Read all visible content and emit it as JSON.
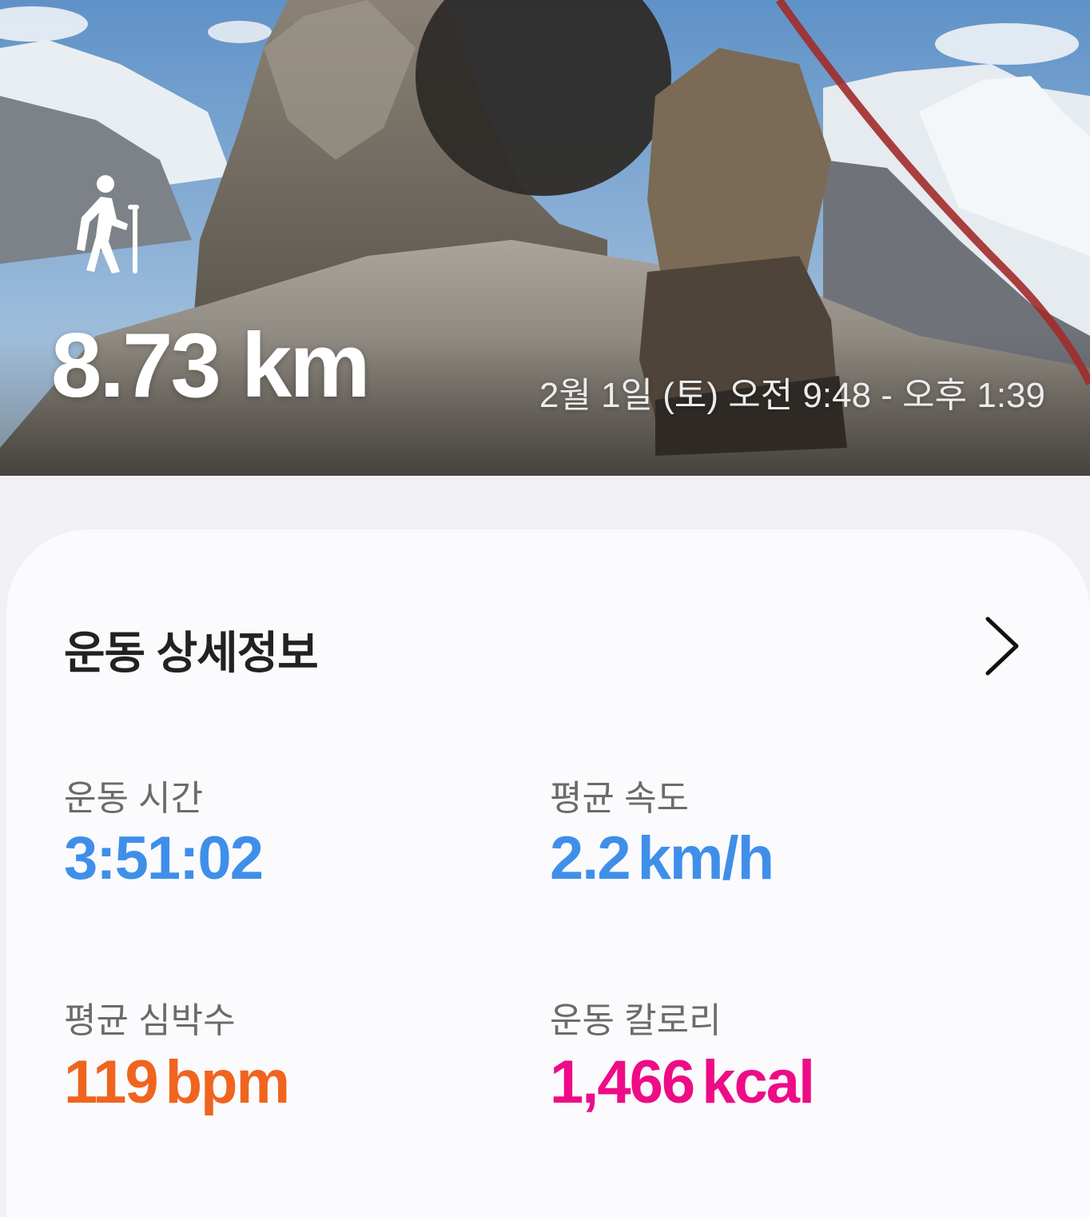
{
  "hero": {
    "activity_icon": "hiking-icon",
    "distance_value": "8.73",
    "distance_unit": "km",
    "time_range": "2월 1일 (토) 오전 9:48 - 오후 1:39"
  },
  "details": {
    "title": "운동 상세정보",
    "more_icon": "chevron-right-icon",
    "stats": [
      {
        "label": "운동 시간",
        "value": "3:51:02",
        "unit": "",
        "color": "#3f8fe9"
      },
      {
        "label": "평균 속도",
        "value": "2.2",
        "unit": "km/h",
        "color": "#3f8fe9"
      },
      {
        "label": "평균 심박수",
        "value": "119",
        "unit": "bpm",
        "color": "#f0641f"
      },
      {
        "label": "운동 칼로리",
        "value": "1,466",
        "unit": "kcal",
        "color": "#ee0c86"
      }
    ]
  }
}
